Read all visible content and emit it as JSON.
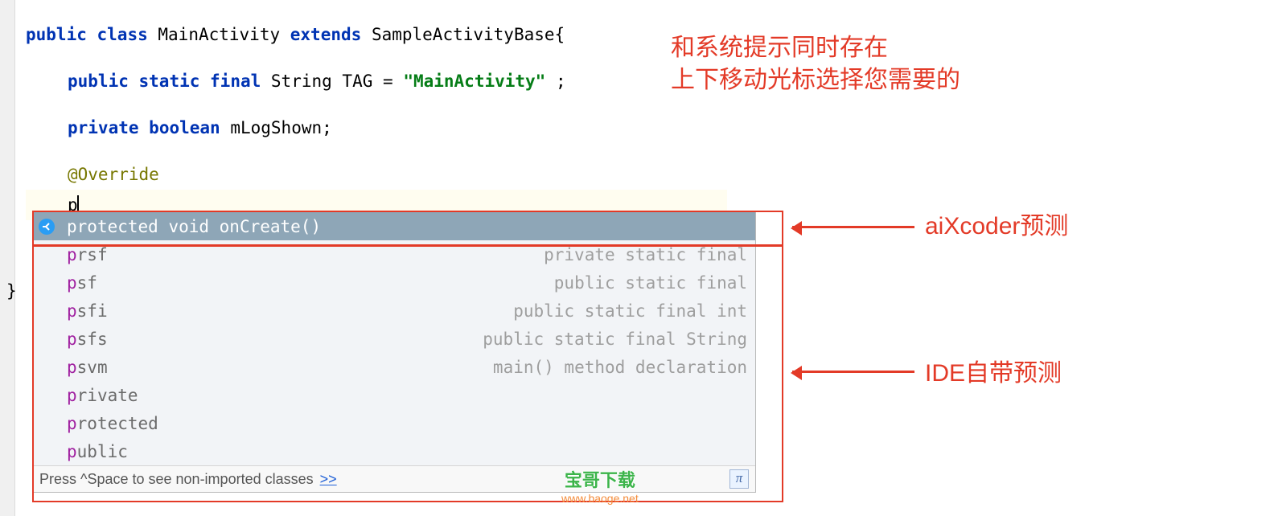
{
  "code": {
    "line1": {
      "k1": "public",
      "k2": "class",
      "name": "MainActivity",
      "k3": "extends",
      "base": "SampleActivityBase{"
    },
    "line2": {
      "k1": "public",
      "k2": "static",
      "k3": "final",
      "type": "String",
      "var": "TAG",
      "eq": " = ",
      "str": "\"MainActivity\"",
      "semi": ";"
    },
    "line3": {
      "k1": "private",
      "k2": "boolean",
      "var": "mLogShown;"
    },
    "line4": {
      "annotation": "@Override"
    },
    "line5": {
      "typed": "p"
    },
    "closeBrace": "}"
  },
  "popup": {
    "ai": {
      "prefix": "p",
      "rest": "rotected void onCreate()"
    },
    "items": [
      {
        "prefix": "p",
        "rest": "rsf",
        "desc": "private static final"
      },
      {
        "prefix": "p",
        "rest": "sf",
        "desc": "public static final"
      },
      {
        "prefix": "p",
        "rest": "sfi",
        "desc": "public static final int"
      },
      {
        "prefix": "p",
        "rest": "sfs",
        "desc": "public static final String"
      },
      {
        "prefix": "p",
        "rest": "svm",
        "desc": "main() method declaration"
      },
      {
        "prefix": "p",
        "rest": "rivate",
        "desc": ""
      },
      {
        "prefix": "p",
        "rest": "rotected",
        "desc": ""
      },
      {
        "prefix": "p",
        "rest": "ublic",
        "desc": ""
      }
    ],
    "footer": {
      "hint": "Press ^Space to see non-imported classes",
      "link": ">>",
      "pi": "π"
    }
  },
  "annotations": {
    "top1": "和系统提示同时存在",
    "top2": "上下移动光标选择您需要的",
    "ai_label": "aiXcoder预测",
    "ide_label": "IDE自带预测"
  },
  "watermark": {
    "title": "宝哥下载",
    "url": "www.baoge.net"
  }
}
